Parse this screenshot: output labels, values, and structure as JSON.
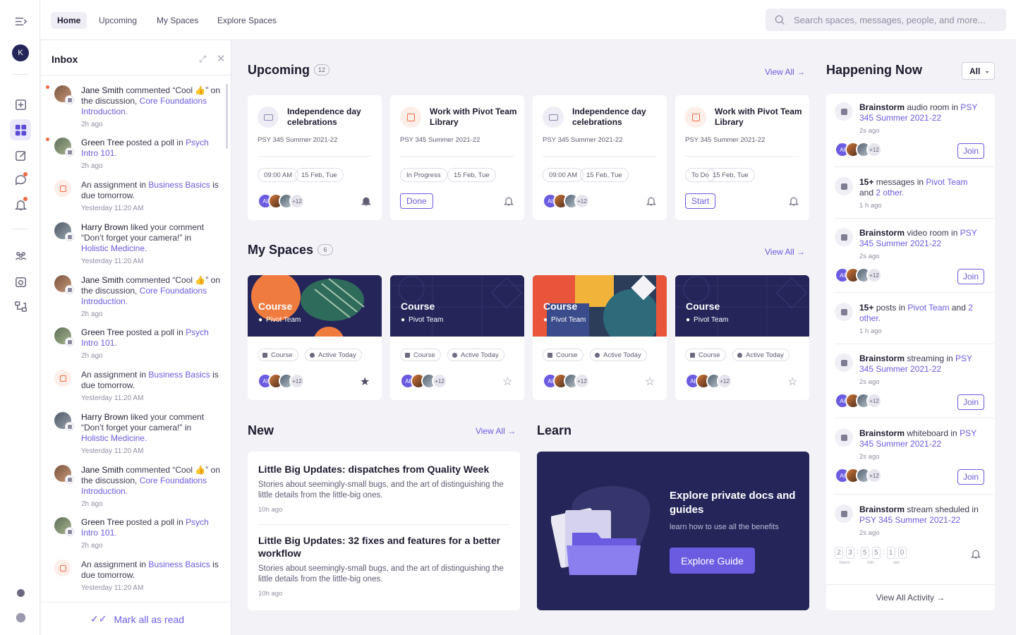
{
  "user": {
    "initial": "K"
  },
  "nav": {
    "tabs": [
      "Home",
      "Upcoming",
      "My Spaces",
      "Explore Spaces"
    ],
    "active": "Home"
  },
  "search": {
    "placeholder": "Search spaces, messages, people, and more..."
  },
  "inbox": {
    "title": "Inbox",
    "items": [
      {
        "actor": "Jane Smith",
        "pre": " commented “Cool 👍” on the discussion, ",
        "link": "Core Foundations Introduction.",
        "post": "",
        "time": "2h ago"
      },
      {
        "actor": "Green Tree",
        "pre": " posted a poll in ",
        "link": "Psych Intro 101.",
        "post": "",
        "time": "2h ago"
      },
      {
        "actor": "",
        "pre": "An assignment in ",
        "link": "Business Basics",
        "post": " is due tomorrow.",
        "time": "Yesterday 11:20 AM"
      },
      {
        "actor": "Harry Brown",
        "pre": " liked your comment “Don’t forget your camera!” in ",
        "link": "Holistic Medicine.",
        "post": "",
        "time": "Yesterday 11:20 AM"
      },
      {
        "actor": "Jane Smith",
        "pre": " commented “Cool 👍” on the discussion, ",
        "link": "Core Foundations Introduction.",
        "post": "",
        "time": "2h ago"
      },
      {
        "actor": "Green Tree",
        "pre": " posted a poll in ",
        "link": "Psych Intro 101.",
        "post": "",
        "time": "2h ago"
      },
      {
        "actor": "",
        "pre": "An assignment in ",
        "link": "Business Basics",
        "post": " is due tomorrow.",
        "time": "Yesterday 11:20 AM"
      },
      {
        "actor": "Harry Brown",
        "pre": " liked your comment “Don’t forget your camera!” in ",
        "link": "Holistic Medicine.",
        "post": "",
        "time": "Yesterday 11:20 AM"
      },
      {
        "actor": "Jane Smith",
        "pre": " commented “Cool 👍” on the discussion, ",
        "link": "Core Foundations Introduction.",
        "post": "",
        "time": "2h ago"
      },
      {
        "actor": "Green Tree",
        "pre": " posted a poll in ",
        "link": "Psych Intro 101.",
        "post": "",
        "time": "2h ago"
      },
      {
        "actor": "",
        "pre": "An assignment in ",
        "link": "Business Basics",
        "post": " is due tomorrow.",
        "time": "Yesterday 11:20 AM"
      }
    ],
    "mark_all": "Mark all as read"
  },
  "upcoming": {
    "title": "Upcoming",
    "count": "12",
    "view_all": "View All",
    "cards": [
      {
        "title": "Independence day celebrations",
        "sub": "PSY 345 Summer 2021-22",
        "chip1": "09:00 AM",
        "chip2": "15 Feb, Tue",
        "action": ""
      },
      {
        "title": "Work with Pivot Team Library",
        "sub": "PSY 345 Summer 2021-22",
        "chip1": "In Progress",
        "chip2": "15 Feb, Tue",
        "action": "Done"
      },
      {
        "title": "Independence day celebrations",
        "sub": "PSY 345 Summer 2021-22",
        "chip1": "09:00 AM",
        "chip2": "15 Feb, Tue",
        "action": ""
      },
      {
        "title": "Work with Pivot Team Library",
        "sub": "PSY 345 Summer 2021-22",
        "chip1": "To Do",
        "chip2": "15 Feb, Tue",
        "action": "Start"
      }
    ]
  },
  "avatars": {
    "first": "AI",
    "more": "+12"
  },
  "spaces": {
    "title": "My Spaces",
    "count": "6",
    "view_all": "View All",
    "cards": [
      {
        "name": "Course",
        "team": "Pivot Team",
        "tag1": "Course",
        "tag2": "Active Today"
      },
      {
        "name": "Course",
        "team": "Pivot Team",
        "tag1": "Course",
        "tag2": "Active Today"
      },
      {
        "name": "Course",
        "team": "Pivot Team",
        "tag1": "Course",
        "tag2": "Active Today"
      },
      {
        "name": "Course",
        "team": "Pivot Team",
        "tag1": "Course",
        "tag2": "Active Today"
      }
    ]
  },
  "new": {
    "title": "New",
    "view_all": "View All",
    "items": [
      {
        "title": "Little Big Updates: dispatches from Quality Week",
        "desc": "Stories about seemingly-small bugs, and the art of distinguishing the little details from the little-big ones.",
        "time": "10h ago"
      },
      {
        "title": "Little Big Updates: 32 fixes and features for a better workflow",
        "desc": "Stories about seemingly-small bugs, and the art of distinguishing the little details from the little-big ones.",
        "time": "10h ago"
      }
    ]
  },
  "learn": {
    "title": "Learn",
    "heading": "Explore private docs and guides",
    "sub": "learn how to use all the benefits",
    "button": "Explore Guide"
  },
  "happening": {
    "title": "Happening Now",
    "filter": "All",
    "items": [
      {
        "icon": "mic-icon",
        "bold": "Brainstorm",
        "pre": " audio room in ",
        "link": "PSY 345 Summer 2021-22",
        "post": "",
        "time": "2s ago",
        "join": "Join"
      },
      {
        "icon": "chat-icon",
        "bold": "15+",
        "pre": " messages in ",
        "link": "Pivot Team",
        "post": " and ",
        "link2": "2 other.",
        "time": "1 h ago",
        "join": ""
      },
      {
        "icon": "video-icon",
        "bold": "Brainstorm",
        "pre": " video room in ",
        "link": "PSY 345 Summer 2021-22",
        "post": "",
        "time": "2s ago",
        "join": "Join"
      },
      {
        "icon": "doc-icon",
        "bold": "15+",
        "pre": " posts in ",
        "link": "Pivot Team",
        "post": " and ",
        "link2": "2 other.",
        "time": "1 h ago",
        "join": ""
      },
      {
        "icon": "stream-icon",
        "bold": "Brainstorm",
        "pre": " streaming in ",
        "link": "PSY 345 Summer 2021-22",
        "post": "",
        "time": "2s ago",
        "join": "Join"
      },
      {
        "icon": "whiteboard-icon",
        "bold": "Brainstorm",
        "pre": " whiteboard in ",
        "link": "PSY 345 Summer 2021-22",
        "post": "",
        "time": "2s ago",
        "join": "Join"
      },
      {
        "icon": "stream-icon",
        "bold": "Brainstorm",
        "pre": " stream sheduled in ",
        "link": "PSY 345 Summer 2021-22",
        "post": "",
        "time": "2s ago",
        "join": ""
      }
    ],
    "countdown": {
      "hours": [
        "2",
        "3"
      ],
      "min": [
        "5",
        "5"
      ],
      "sec": [
        "1",
        "0"
      ],
      "labels": [
        "hours",
        "min",
        "sec"
      ]
    },
    "view_all": "View All Activity"
  },
  "colors": {
    "accent": "#6b5be0",
    "navy": "#25255a",
    "alert": "#f06a45"
  }
}
